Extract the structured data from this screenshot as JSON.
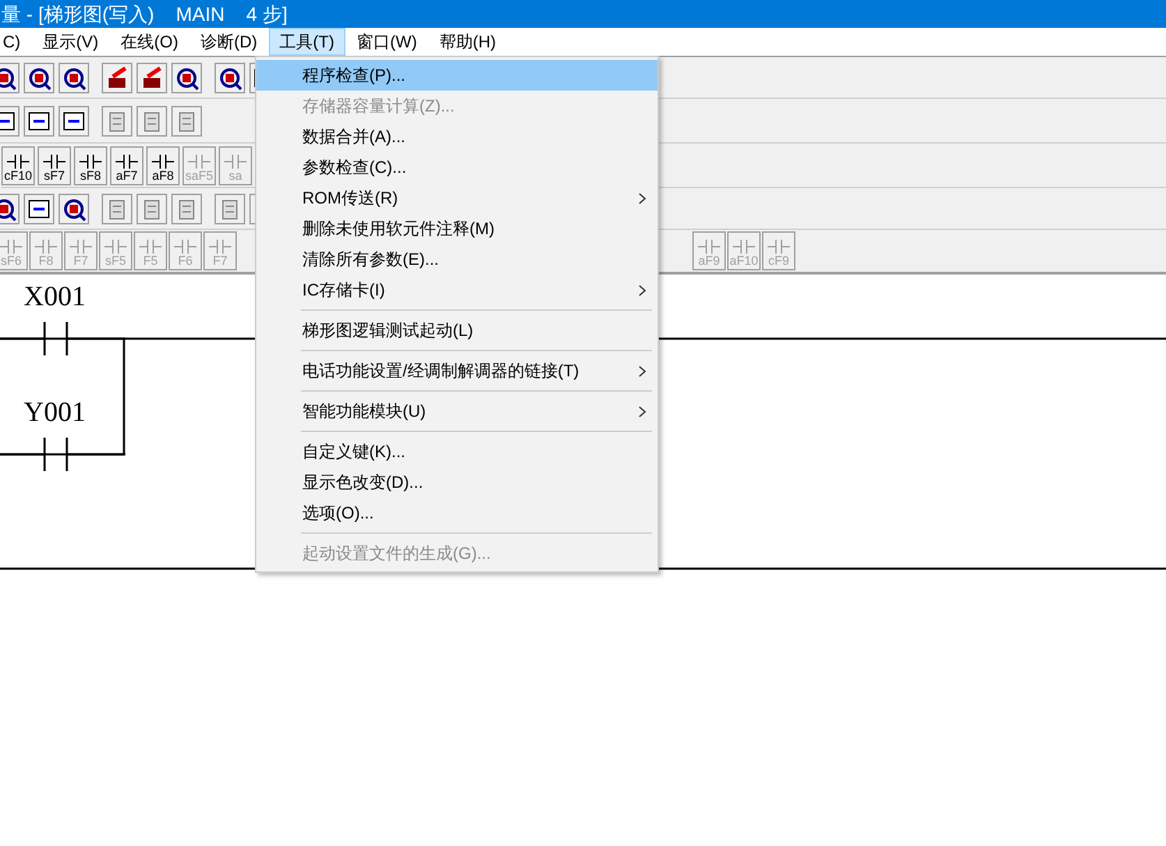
{
  "window": {
    "title": "量 - [梯形图(写入)    MAIN    4 步]"
  },
  "menu_bar": [
    {
      "label": "C)",
      "selected": false
    },
    {
      "label": "显示(V)",
      "selected": false
    },
    {
      "label": "在线(O)",
      "selected": false
    },
    {
      "label": "诊断(D)",
      "selected": false
    },
    {
      "label": "工具(T)",
      "selected": true
    },
    {
      "label": "窗口(W)",
      "selected": false
    },
    {
      "label": "帮助(H)",
      "selected": false
    }
  ],
  "function_keys_upper": [
    {
      "label": "cF10",
      "disabled": false
    },
    {
      "label": "sF7",
      "disabled": false
    },
    {
      "label": "sF8",
      "disabled": false
    },
    {
      "label": "aF7",
      "disabled": false
    },
    {
      "label": "aF8",
      "disabled": false
    },
    {
      "label": "saF5",
      "disabled": true
    },
    {
      "label": "sa",
      "disabled": true
    }
  ],
  "function_keys_lower": [
    {
      "label": "sF6",
      "disabled": true
    },
    {
      "label": "F8",
      "disabled": true
    },
    {
      "label": "F7",
      "disabled": true
    },
    {
      "label": "sF5",
      "disabled": true
    },
    {
      "label": "F5",
      "disabled": true
    },
    {
      "label": "F6",
      "disabled": true
    },
    {
      "label": "F7",
      "disabled": true
    }
  ],
  "function_keys_lower_right": [
    {
      "label": "aF9",
      "disabled": true
    },
    {
      "label": "aF10",
      "disabled": true
    },
    {
      "label": "cF9",
      "disabled": true
    }
  ],
  "ladder": {
    "contacts": [
      {
        "device": "X001"
      },
      {
        "device": "Y001"
      }
    ]
  },
  "tools_menu": [
    {
      "kind": "item",
      "label": "程序检查(P)...",
      "selected": true,
      "disabled": false,
      "submenu": false
    },
    {
      "kind": "item",
      "label": "存储器容量计算(Z)...",
      "selected": false,
      "disabled": true,
      "submenu": false
    },
    {
      "kind": "item",
      "label": "数据合并(A)...",
      "selected": false,
      "disabled": false,
      "submenu": false
    },
    {
      "kind": "item",
      "label": "参数检查(C)...",
      "selected": false,
      "disabled": false,
      "submenu": false
    },
    {
      "kind": "item",
      "label": "ROM传送(R)",
      "selected": false,
      "disabled": false,
      "submenu": true
    },
    {
      "kind": "item",
      "label": "删除未使用软元件注释(M)",
      "selected": false,
      "disabled": false,
      "submenu": false
    },
    {
      "kind": "item",
      "label": "清除所有参数(E)...",
      "selected": false,
      "disabled": false,
      "submenu": false
    },
    {
      "kind": "item",
      "label": "IC存储卡(I)",
      "selected": false,
      "disabled": false,
      "submenu": true
    },
    {
      "kind": "separator"
    },
    {
      "kind": "item",
      "label": "梯形图逻辑测试起动(L)",
      "selected": false,
      "disabled": false,
      "submenu": false
    },
    {
      "kind": "separator"
    },
    {
      "kind": "item",
      "label": "电话功能设置/经调制解调器的链接(T)",
      "selected": false,
      "disabled": false,
      "submenu": true
    },
    {
      "kind": "separator"
    },
    {
      "kind": "item",
      "label": "智能功能模块(U)",
      "selected": false,
      "disabled": false,
      "submenu": true
    },
    {
      "kind": "separator"
    },
    {
      "kind": "item",
      "label": "自定义键(K)...",
      "selected": false,
      "disabled": false,
      "submenu": false
    },
    {
      "kind": "item",
      "label": "显示色改变(D)...",
      "selected": false,
      "disabled": false,
      "submenu": false
    },
    {
      "kind": "item",
      "label": "选项(O)...",
      "selected": false,
      "disabled": false,
      "submenu": false
    },
    {
      "kind": "separator"
    },
    {
      "kind": "item",
      "label": "起动设置文件的生成(G)...",
      "selected": false,
      "disabled": true,
      "submenu": false
    }
  ]
}
